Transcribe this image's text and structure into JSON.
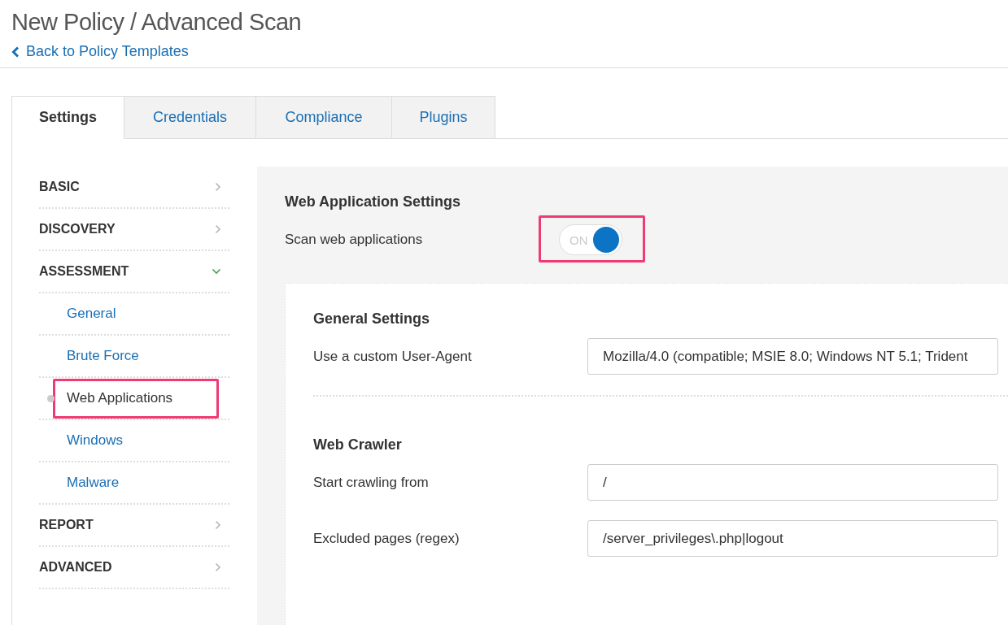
{
  "page": {
    "title": "New Policy / Advanced Scan",
    "back_link": "Back to Policy Templates"
  },
  "tabs": [
    {
      "label": "Settings",
      "selected": true
    },
    {
      "label": "Credentials",
      "selected": false
    },
    {
      "label": "Compliance",
      "selected": false
    },
    {
      "label": "Plugins",
      "selected": false
    }
  ],
  "sidebar": {
    "items": [
      {
        "label": "BASIC",
        "expanded": false
      },
      {
        "label": "DISCOVERY",
        "expanded": false
      },
      {
        "label": "ASSESSMENT",
        "expanded": true,
        "children": [
          {
            "label": "General",
            "selected": false,
            "highlighted": false
          },
          {
            "label": "Brute Force",
            "selected": false,
            "highlighted": false
          },
          {
            "label": "Web Applications",
            "selected": true,
            "highlighted": true
          },
          {
            "label": "Windows",
            "selected": false,
            "highlighted": false
          },
          {
            "label": "Malware",
            "selected": false,
            "highlighted": false
          }
        ]
      },
      {
        "label": "REPORT",
        "expanded": false
      },
      {
        "label": "ADVANCED",
        "expanded": false
      }
    ]
  },
  "main": {
    "title": "Web Application Settings",
    "toggle": {
      "label": "Scan web applications",
      "on": true,
      "text": "ON",
      "highlighted": true
    },
    "sections": [
      {
        "title": "General Settings",
        "fields": [
          {
            "label": "Use a custom User-Agent",
            "value": "Mozilla/4.0 (compatible; MSIE 8.0; Windows NT 5.1; Trident"
          }
        ]
      },
      {
        "title": "Web Crawler",
        "fields": [
          {
            "label": "Start crawling from",
            "value": "/"
          },
          {
            "label": "Excluded pages (regex)",
            "value": "/server_privileges\\.php|logout"
          }
        ]
      }
    ]
  }
}
